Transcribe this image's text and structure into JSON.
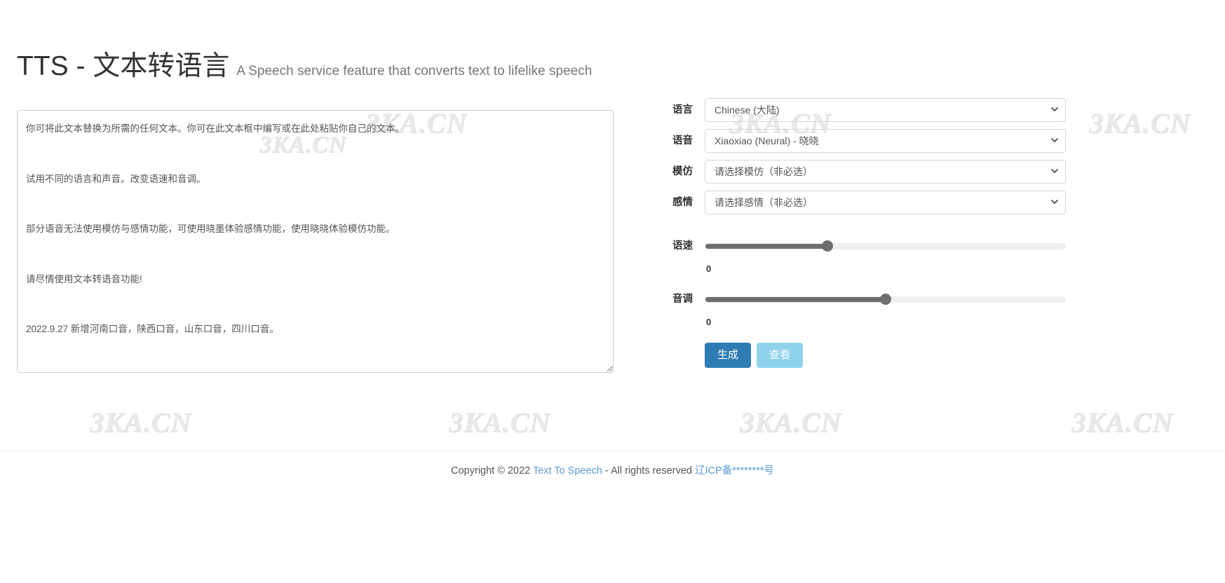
{
  "header": {
    "title": "TTS - 文本转语言",
    "subtitle": "A Speech service feature that converts text to lifelike speech"
  },
  "editor": {
    "text": "你可将此文本替换为所需的任何文本。你可在此文本框中编写或在此处粘贴你自己的文本。\n\n试用不同的语言和声音。改变语速和音调。\n\n部分语音无法使用模仿与感情功能，可使用晓墨体验感情功能，使用晓晓体验模仿功能。\n\n请尽情使用文本转语音功能!\n\n2022.9.27 新增河南口音，陕西口音，山东口音，四川口音。",
    "placeholder": ""
  },
  "form": {
    "language": {
      "label": "语言",
      "value": "Chinese (大陆)",
      "options": [
        "Chinese (大陆)"
      ]
    },
    "voice": {
      "label": "语音",
      "value": "Xiaoxiao (Neural) - 晓晓",
      "options": [
        "Xiaoxiao (Neural) - 晓晓"
      ]
    },
    "imitation": {
      "label": "模仿",
      "value": "请选择模仿（非必选）",
      "options": [
        "请选择模仿（非必选）"
      ]
    },
    "emotion": {
      "label": "感情",
      "value": "请选择感情（非必选）",
      "options": [
        "请选择感情（非必选）"
      ]
    },
    "rate": {
      "label": "语速",
      "value": "0",
      "percent": 34
    },
    "pitch": {
      "label": "音调",
      "value": "0",
      "percent": 50
    },
    "buttons": {
      "generate": "生成",
      "view": "查看"
    }
  },
  "footer": {
    "copyright_prefix": "Copyright © 2022 ",
    "brand_link": "Text To Speech",
    "rights": " - All rights reserved ",
    "icp": "辽ICP备********号"
  },
  "watermark": {
    "text": "3KA.CN"
  },
  "colors": {
    "primary_button": "#2e7cb4",
    "secondary_button": "#90d2ea",
    "link": "#5b9bd5",
    "slider_fill": "#6e6e6e"
  }
}
